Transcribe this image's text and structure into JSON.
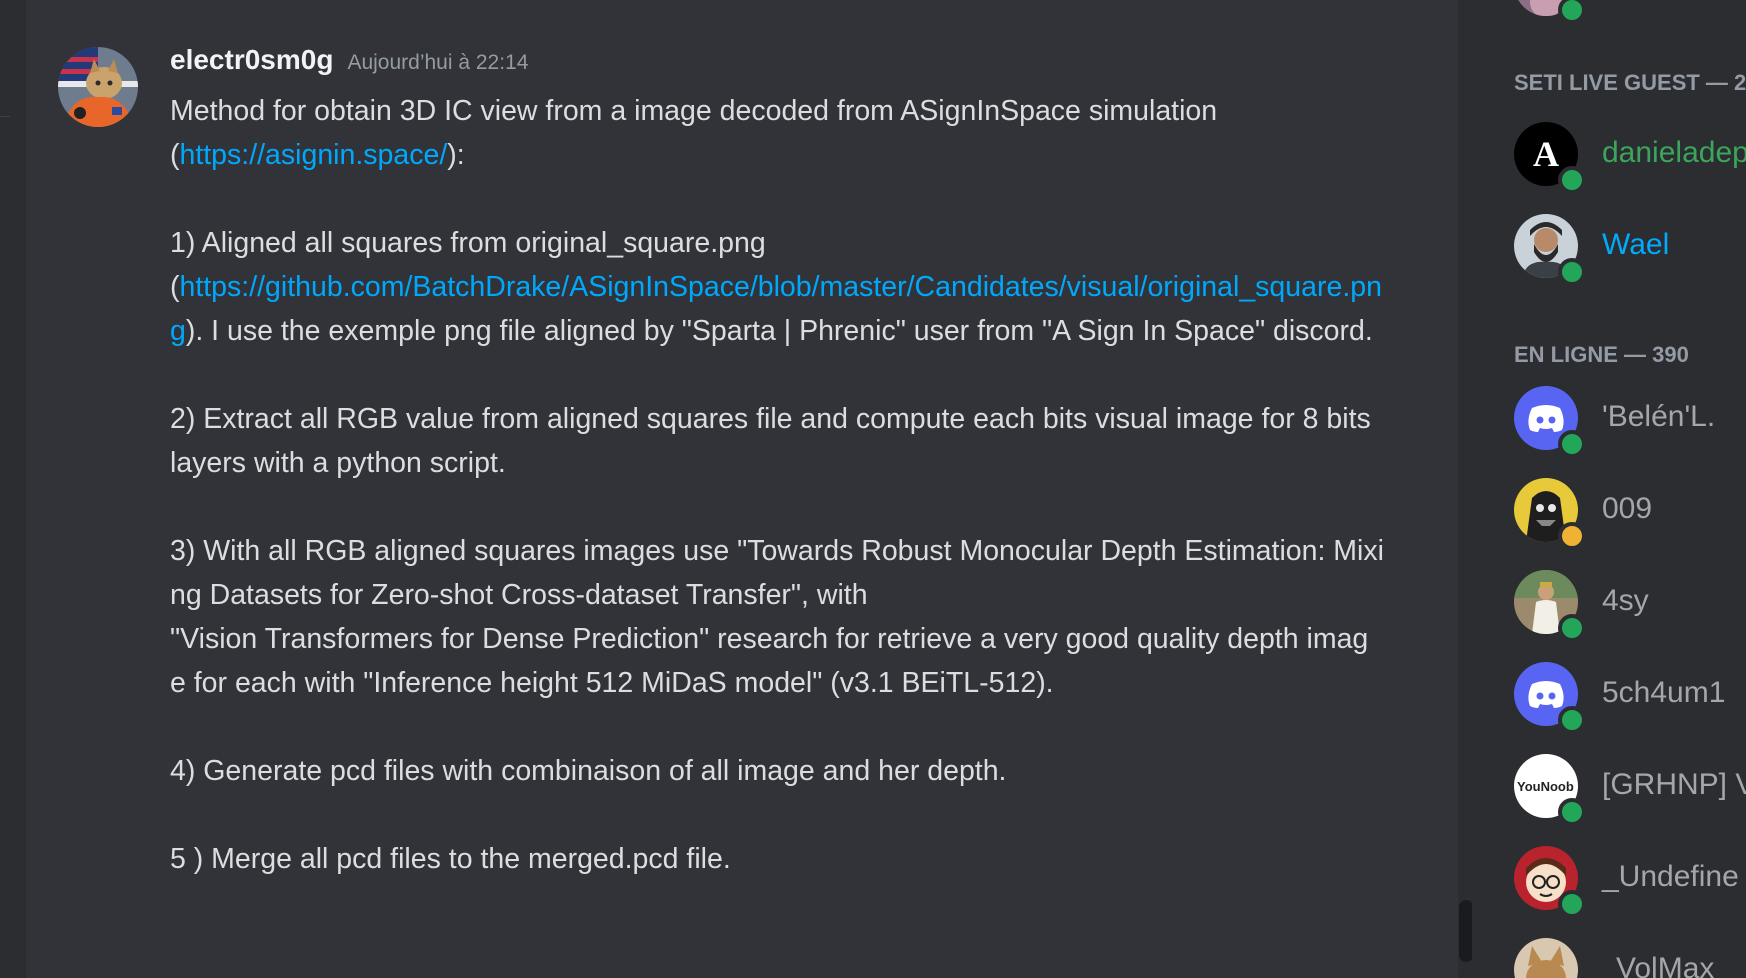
{
  "message": {
    "username": "electr0sm0g",
    "timestamp": "Aujourd’hui à 22:14",
    "intro_text": "Method for obtain 3D IC view from a image decoded from ASignInSpace simulation\n(",
    "intro_link": "https://asignin.space/",
    "intro_end": "):\n\n1) Aligned all squares from original_square.png\n(",
    "step1_link": "https://github.com/BatchDrake/ASignInSpace/blob/master/Candidates/visual/original_square.png",
    "step1_after": "). I use the exemple png file aligned by \"Sparta | Phrenic\" user from \"A Sign In Space\" discord.\n\n2) Extract all RGB value from aligned squares file and compute each bits visual image for 8 bits layers with a python script.\n\n3) With all RGB aligned squares images use \"Towards Robust Monocular Depth Estimation: Mixing Datasets for Zero-shot Cross-dataset Transfer\", with\n\"Vision Transformers for Dense Prediction\" research for retrieve a very good quality depth image for each with \"Inference height 512 MiDaS model\" (v3.1 BEiTL-512).\n\n4) Generate pcd files with combinaison of all image and her depth.\n\n5 ) Merge all pcd files to the merged.pcd file.",
    "link_color": "#00a8fc"
  },
  "members": {
    "section_guest": "SETI LIVE GUEST — 2",
    "section_online": "EN LIGNE — 390",
    "guests": [
      {
        "name": "danieladep",
        "color": "#3ba55c",
        "icon": "letter-a-avatar"
      },
      {
        "name": "Wael",
        "color": "#00aafc",
        "icon": "bearded-man-avatar"
      }
    ],
    "online": [
      {
        "name": "'Belén'L.",
        "icon": "discord-default-avatar",
        "status": "online"
      },
      {
        "name": "009",
        "icon": "comic-character-avatar",
        "status": "idle"
      },
      {
        "name": "4sy",
        "icon": "person-photo-avatar",
        "status": "online"
      },
      {
        "name": "5ch4um1",
        "icon": "discord-default-avatar",
        "status": "online"
      },
      {
        "name": "[GRHNP] V",
        "icon": "youtube-noob-avatar",
        "avatar_text": "YouNoob",
        "status": "online"
      },
      {
        "name": "_Undefine",
        "icon": "cartoon-face-avatar",
        "status": "online"
      },
      {
        "name": "VolMax",
        "icon": "cat-avatar",
        "status": "online"
      }
    ],
    "status_colors": {
      "online": "#23a55a",
      "idle": "#f0b232"
    }
  }
}
